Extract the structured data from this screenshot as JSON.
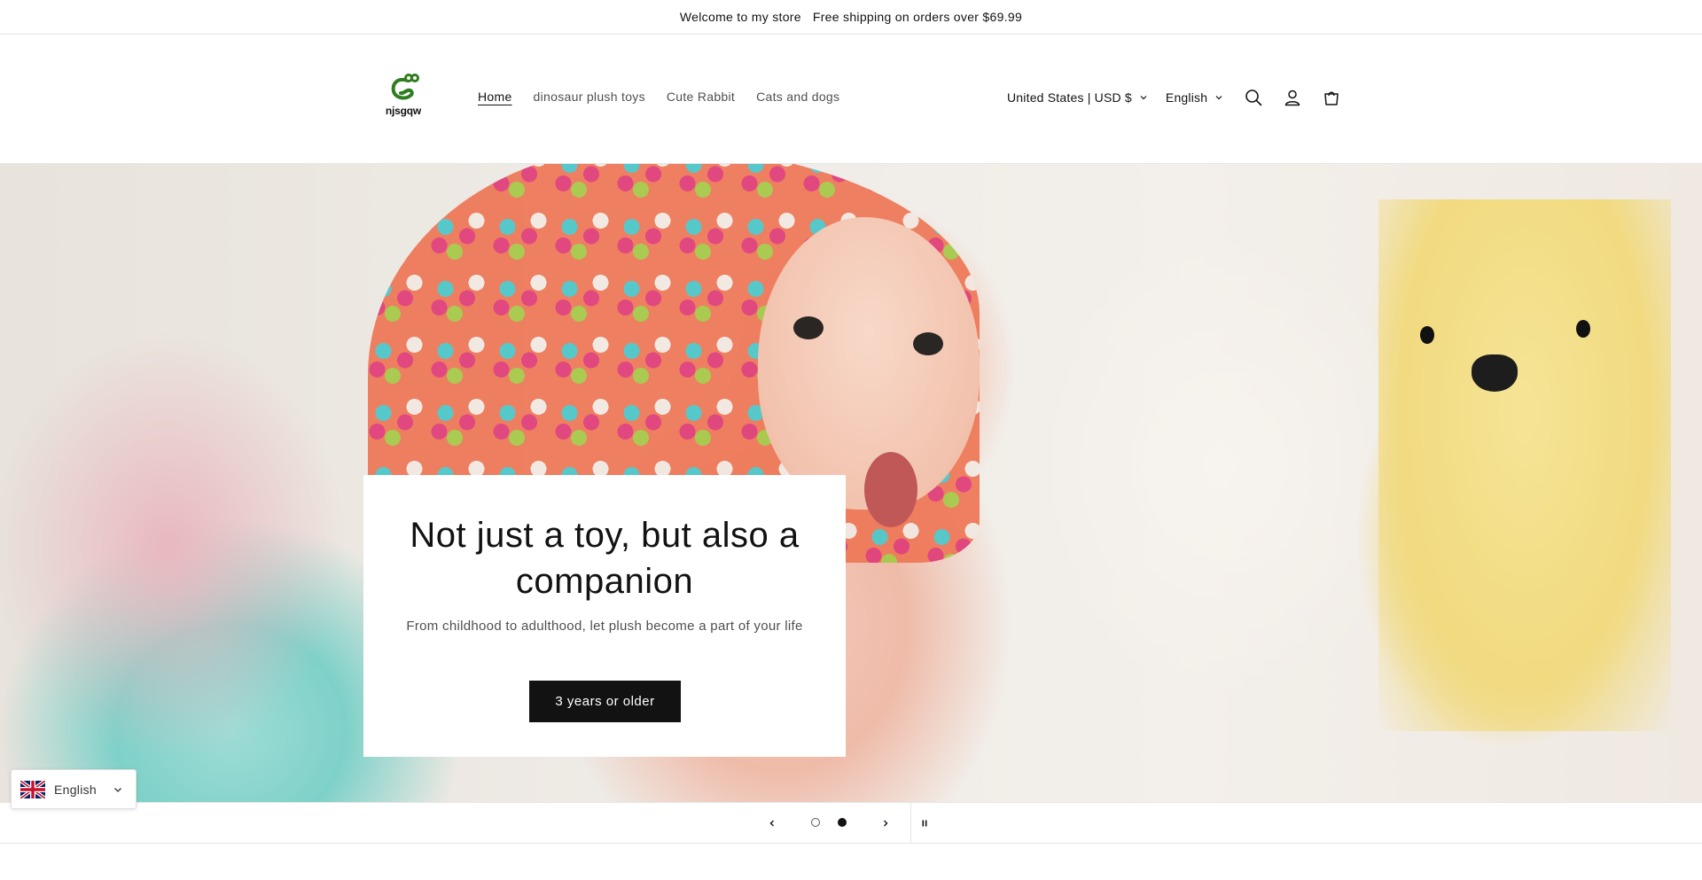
{
  "announcement": {
    "welcome": "Welcome to my store",
    "shipping": "Free shipping on orders over $69.99"
  },
  "header": {
    "logo_text": "njsgqw",
    "nav": [
      {
        "label": "Home",
        "active": true
      },
      {
        "label": "dinosaur plush toys",
        "active": false
      },
      {
        "label": "Cute Rabbit",
        "active": false
      },
      {
        "label": "Cats and dogs",
        "active": false
      }
    ],
    "country_selector": "United States | USD $",
    "language_selector": "English",
    "icons": [
      "search-icon",
      "account-icon",
      "cart-icon"
    ]
  },
  "hero": {
    "title": "Not just a toy, but also a companion",
    "subtitle": "From childhood to adulthood, let plush become a part of your life",
    "button_label": "3 years or older"
  },
  "slider": {
    "slide_count": 2,
    "current_slide": 2,
    "icons": [
      "chevron-left-icon",
      "chevron-right-icon",
      "pause-icon"
    ]
  },
  "language_widget": {
    "label": "English",
    "flag": "uk-flag-icon"
  },
  "colors": {
    "text": "#121212",
    "button_bg": "#121212",
    "button_text": "#ffffff",
    "logo_green": "#2e7d1e"
  }
}
